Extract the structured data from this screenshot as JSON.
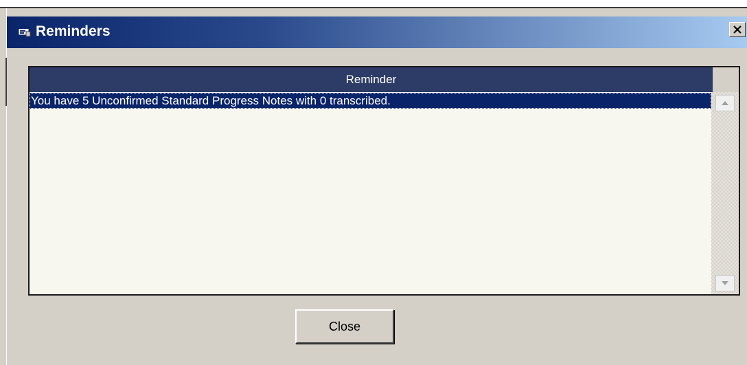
{
  "window": {
    "title": "Reminders",
    "icon": "reminder-window-icon",
    "close_glyph": "×"
  },
  "grid": {
    "column_header": "Reminder",
    "rows": [
      {
        "text": "You have 5 Unconfirmed Standard Progress Notes with 0 transcribed.",
        "selected": true
      }
    ]
  },
  "scrollbar": {
    "up_icon": "arrow-up-icon",
    "down_icon": "arrow-down-icon"
  },
  "buttons": {
    "close_label": "Close"
  },
  "colors": {
    "titlebar_start": "#0a246a",
    "titlebar_end": "#a6caf0",
    "header_bg": "#2c3c66",
    "selection_bg": "#0a246a",
    "grid_bg": "#f7f6ef",
    "dialog_bg": "#d4d0c8"
  }
}
